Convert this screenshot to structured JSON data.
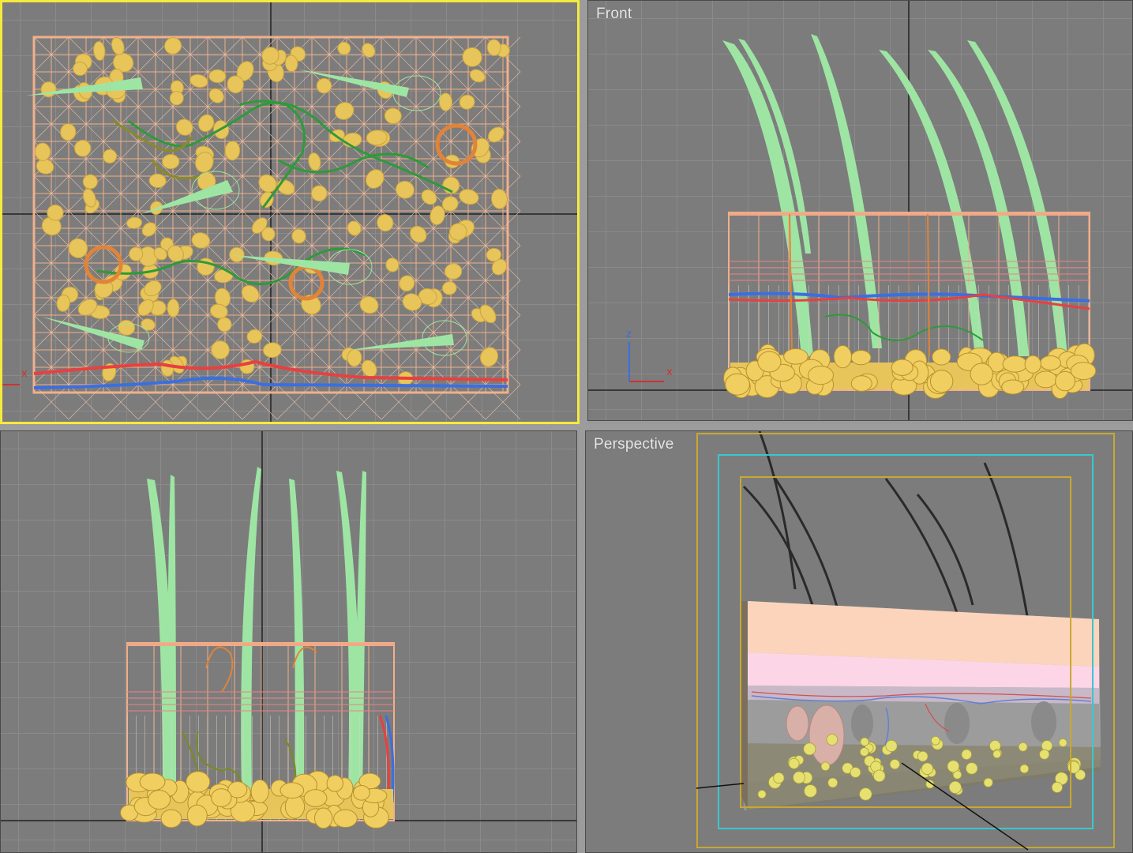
{
  "viewports": {
    "top": {
      "label": "",
      "active": true
    },
    "front": {
      "label": "Front",
      "active": false
    },
    "left": {
      "label": "",
      "active": false
    },
    "perspective": {
      "label": "Perspective",
      "active": false
    }
  },
  "axis_labels": {
    "x": "x",
    "z": "z"
  },
  "colors": {
    "viewport_bg": "#7c7c7c",
    "grid": "#8c8c8c",
    "active_border": "#f6ea3c",
    "hair": "#9ee5a4",
    "mesh": "#f0b08a",
    "fat": "#e8c55a",
    "vessel_red": "#e84040",
    "vessel_blue": "#3a6fe0",
    "nerve_green": "#2e9a3a",
    "gland_orange": "#e0843a",
    "safe_frame_cyan": "#39c8d0",
    "safe_frame_yellow": "#c8a830"
  }
}
